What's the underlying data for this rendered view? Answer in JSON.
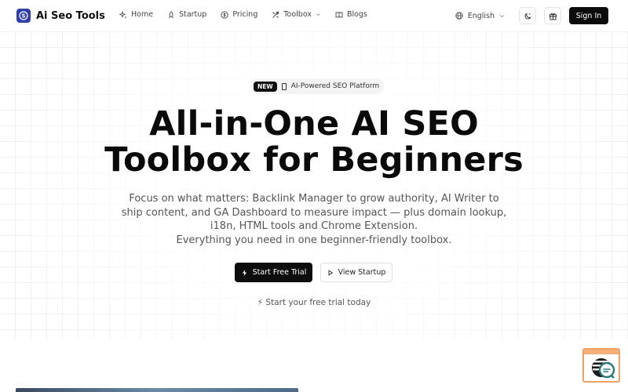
{
  "brand": {
    "name": "Ai Seo Tools",
    "accent": "#2f3ea8"
  },
  "nav": [
    {
      "label": "Home",
      "icon": "sparkles-icon"
    },
    {
      "label": "Startup",
      "icon": "rocket-icon"
    },
    {
      "label": "Pricing",
      "icon": "dollar-circle-icon"
    },
    {
      "label": "Toolbox",
      "icon": "tools-icon",
      "has_dropdown": true
    },
    {
      "label": "Blogs",
      "icon": "book-icon"
    }
  ],
  "header": {
    "language": "English",
    "sign_in": "Sign In"
  },
  "hero": {
    "badge_tag": "NEW",
    "badge_text": "AI-Powered SEO Platform",
    "title_line1": "All-in-One AI SEO",
    "title_line2": "Toolbox for Beginners",
    "desc_line1": "Focus on what matters: Backlink Manager to grow authority, AI Writer to",
    "desc_line2": "ship content, and GA Dashboard to measure impact — plus domain lookup,",
    "desc_line3": "i18n, HTML tools and Chrome Extension.",
    "desc_line4": "Everything you need in one beginner-friendly toolbox.",
    "cta_primary": "Start Free Trial",
    "cta_secondary": "View Startup",
    "trial_note": "⚡ Start your free trial today"
  }
}
